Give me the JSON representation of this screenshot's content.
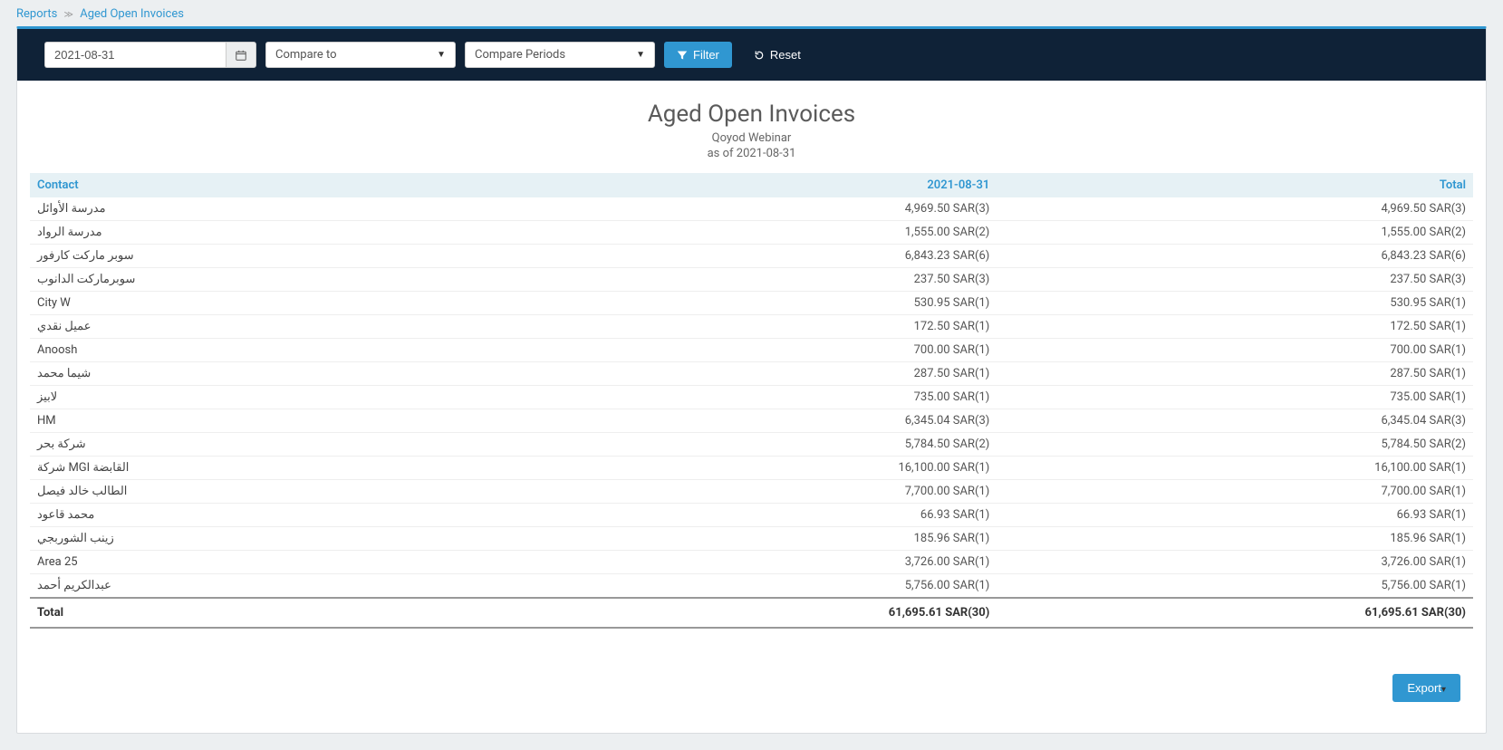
{
  "breadcrumb": {
    "root": "Reports",
    "current": "Aged Open Invoices"
  },
  "filters": {
    "date_value": "2021-08-31",
    "compare_to_label": "Compare to",
    "compare_periods_label": "Compare Periods",
    "filter_btn": "Filter",
    "reset_btn": "Reset"
  },
  "report": {
    "title": "Aged Open Invoices",
    "org": "Qoyod Webinar",
    "as_of": "as of 2021-08-31"
  },
  "columns": {
    "contact": "Contact",
    "period": "2021-08-31",
    "total": "Total"
  },
  "rows": [
    {
      "contact": "مدرسة الأوائل",
      "period": "4,969.50 SAR(3)",
      "total": "4,969.50 SAR(3)"
    },
    {
      "contact": "مدرسة الرواد",
      "period": "1,555.00 SAR(2)",
      "total": "1,555.00 SAR(2)"
    },
    {
      "contact": "سوبر ماركت كارفور",
      "period": "6,843.23 SAR(6)",
      "total": "6,843.23 SAR(6)"
    },
    {
      "contact": "سوبرماركت الدانوب",
      "period": "237.50 SAR(3)",
      "total": "237.50 SAR(3)"
    },
    {
      "contact": "City W",
      "period": "530.95 SAR(1)",
      "total": "530.95 SAR(1)"
    },
    {
      "contact": "عميل نقدي",
      "period": "172.50 SAR(1)",
      "total": "172.50 SAR(1)"
    },
    {
      "contact": "Anoosh",
      "period": "700.00 SAR(1)",
      "total": "700.00 SAR(1)"
    },
    {
      "contact": "شيما محمد",
      "period": "287.50 SAR(1)",
      "total": "287.50 SAR(1)"
    },
    {
      "contact": "لابيز",
      "period": "735.00 SAR(1)",
      "total": "735.00 SAR(1)"
    },
    {
      "contact": "HM",
      "period": "6,345.04 SAR(3)",
      "total": "6,345.04 SAR(3)"
    },
    {
      "contact": "شركة بحر",
      "period": "5,784.50 SAR(2)",
      "total": "5,784.50 SAR(2)"
    },
    {
      "contact": "شركة MGI القابضة",
      "period": "16,100.00 SAR(1)",
      "total": "16,100.00 SAR(1)"
    },
    {
      "contact": "الطالب خالد فيصل",
      "period": "7,700.00 SAR(1)",
      "total": "7,700.00 SAR(1)"
    },
    {
      "contact": "محمد قاعود",
      "period": "66.93 SAR(1)",
      "total": "66.93 SAR(1)"
    },
    {
      "contact": "زينب الشوربجي",
      "period": "185.96 SAR(1)",
      "total": "185.96 SAR(1)"
    },
    {
      "contact": "Area 25",
      "period": "3,726.00 SAR(1)",
      "total": "3,726.00 SAR(1)"
    },
    {
      "contact": "عبدالكريم أحمد",
      "period": "5,756.00 SAR(1)",
      "total": "5,756.00 SAR(1)"
    }
  ],
  "footer": {
    "label": "Total",
    "period": "61,695.61 SAR(30)",
    "total": "61,695.61 SAR(30)"
  },
  "export_label": "Export"
}
